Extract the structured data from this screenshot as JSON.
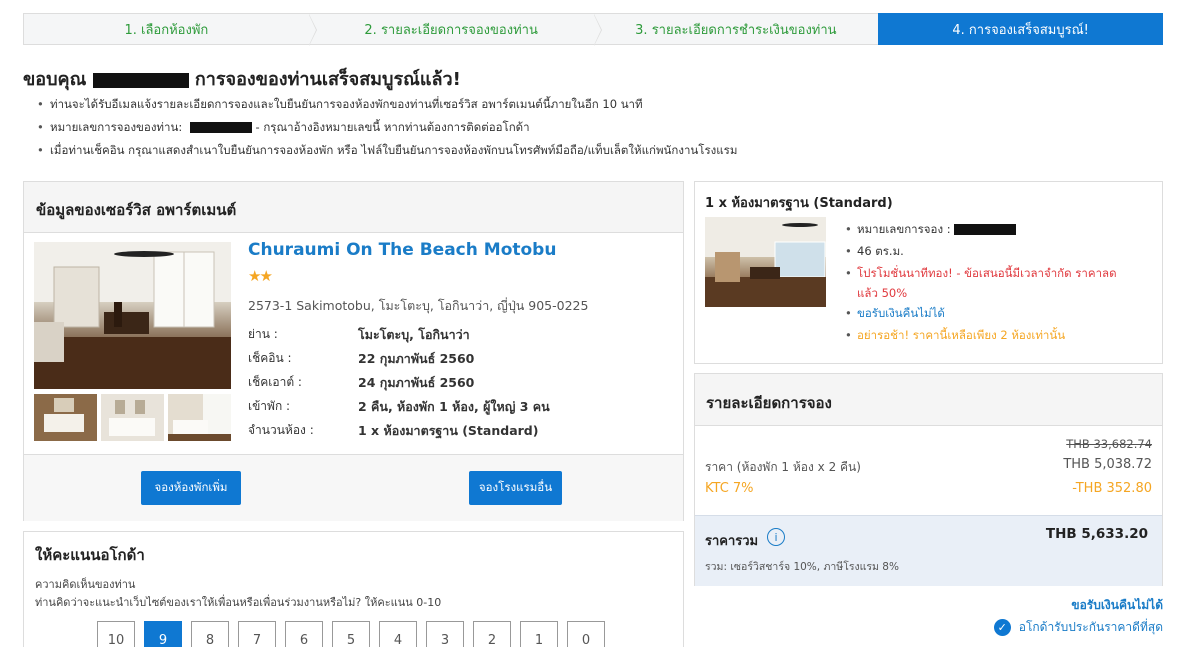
{
  "steps": [
    {
      "label": "1. เลือกห้องพัก"
    },
    {
      "label": "2. รายละเอียดการจองของท่าน"
    },
    {
      "label": "3. รายละเอียดการชำระเงินของท่าน"
    },
    {
      "label": "4. การจองเสร็จสมบูรณ์!"
    }
  ],
  "header": {
    "thanks_prefix": "ขอบคุณ",
    "thanks_suffix": "การจองของท่านเสร็จสมบูรณ์แล้ว!",
    "bullets": [
      "ท่านจะได้รับอีเมลแจ้งรายละเอียดการจองและใบยืนยันการจองห้องพักของท่านที่เซอร์วิส อพาร์ตเมนต์นี้ภายในอีก 10 นาที",
      "หมายเลขการจองของท่าน:",
      "- กรุณาอ้างอิงหมายเลขนี้ หากท่านต้องการติดต่ออโกด้า",
      "เมื่อท่านเช็คอิน กรุณาแสดงสำเนาใบยืนยันการจองห้องพัก หรือ ไฟล์ใบยืนยันการจองห้องพักบนโทรศัพท์มือถือ/แท็บเล็ตให้แก่พนักงานโรงแรม"
    ]
  },
  "property": {
    "panel_title": "ข้อมูลของเซอร์วิส อพาร์ตเมนต์",
    "name": "Churaumi On The Beach Motobu",
    "stars": "★★",
    "address": "2573-1 Sakimotobu, โมะโตะบุ, โอกินาว่า, ญี่ปุ่น 905-0225",
    "details": [
      {
        "key": "ย่าน :",
        "value": "โมะโตะบุ, โอกินาว่า"
      },
      {
        "key": "เช็คอิน :",
        "value": "22 กุมภาพันธ์ 2560"
      },
      {
        "key": "เช็คเอาต์ :",
        "value": "24 กุมภาพันธ์ 2560"
      },
      {
        "key": "เข้าพัก :",
        "value": "2 คืน, ห้องพัก 1 ห้อง, ผู้ใหญ่ 3 คน"
      },
      {
        "key": "จำนวนห้อง :",
        "value": "1 x ห้องมาตรฐาน (Standard)"
      }
    ],
    "btn_more_rooms": "จองห้องพักเพิ่ม",
    "btn_other_hotel": "จองโรงแรมอื่น"
  },
  "rating": {
    "title": "ให้คะแนนอโกด้า",
    "q1": "ความคิดเห็นของท่าน",
    "q2": "ท่านคิดว่าจะแนะนำเว็บไซต์ของเราให้เพื่อนหรือเพื่อนร่วมงานหรือไม่? ให้คะแนน 0-10",
    "scores": [
      "10",
      "9",
      "8",
      "7",
      "6",
      "5",
      "4",
      "3",
      "2",
      "1",
      "0"
    ],
    "selected": "9"
  },
  "room": {
    "title": "1 x ห้องมาตรฐาน (Standard)",
    "booking_no_label": "หมายเลขการจอง :",
    "size": "46 ตร.ม.",
    "promo": "โปรโมชั่นนาทีทอง! - ข้อเสนอนี้มีเวลาจำกัด ราคาลดแล้ว 50%",
    "nonrefundable": "ขอรับเงินคืนไม่ได้",
    "hurry": "อย่ารอช้า! ราคานี้เหลือเพียง 2 ห้องเท่านั้น"
  },
  "booking": {
    "title": "รายละเอียดการจอง",
    "original_price": "THB 33,682.74",
    "price_label": "ราคา (ห้องพัก 1 ห้อง x 2 คืน)",
    "price_value": "THB 5,038.72",
    "discount_label": "KTC 7%",
    "discount_value": "-THB 352.80",
    "total_label": "ราคารวม",
    "total_value": "THB 5,633.20",
    "tax_note": "รวม: เซอร์วิสชาร์จ 10%, ภาษีโรงแรม 8%"
  },
  "footer": {
    "refund": "ขอรับเงินคืนไม่ได้",
    "guarantee": "อโกด้ารับประกันราคาดีที่สุด"
  },
  "colors": {
    "accent": "#0f78d2",
    "step_text": "#2e9b3b",
    "promo_red": "#e0393e",
    "orange": "#f5a623"
  }
}
